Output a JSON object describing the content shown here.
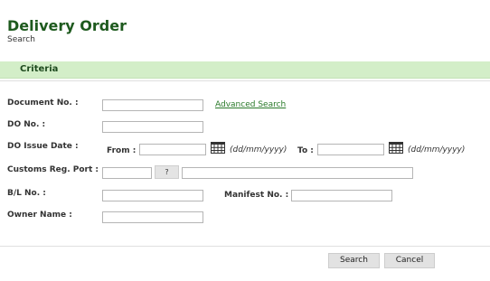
{
  "header": {
    "title": "Delivery Order",
    "subtitle": "Search"
  },
  "criteria": {
    "section_label": "Criteria"
  },
  "form": {
    "document_no": {
      "label": "Document No. :",
      "value": ""
    },
    "advanced_search_link": "Advanced Search",
    "do_no": {
      "label": "DO No. :",
      "value": ""
    },
    "do_issue_date": {
      "label": "DO Issue Date :",
      "from_label": "From :",
      "from_value": "",
      "to_label": "To :",
      "to_value": "",
      "date_format_hint": "(dd/mm/yyyy)"
    },
    "customs_reg_port": {
      "label": "Customs Reg. Port :",
      "code_value": "",
      "lookup_label": "?",
      "name_value": ""
    },
    "bl_no": {
      "label": "B/L No. :",
      "value": ""
    },
    "manifest_no": {
      "label": "Manifest No. :",
      "value": ""
    },
    "owner_name": {
      "label": "Owner Name :",
      "value": ""
    }
  },
  "actions": {
    "search_label": "Search",
    "cancel_label": "Cancel"
  },
  "colors": {
    "title": "#1e5a1e",
    "criteria_bar": "#d3eec8",
    "link": "#2a7a2a"
  }
}
